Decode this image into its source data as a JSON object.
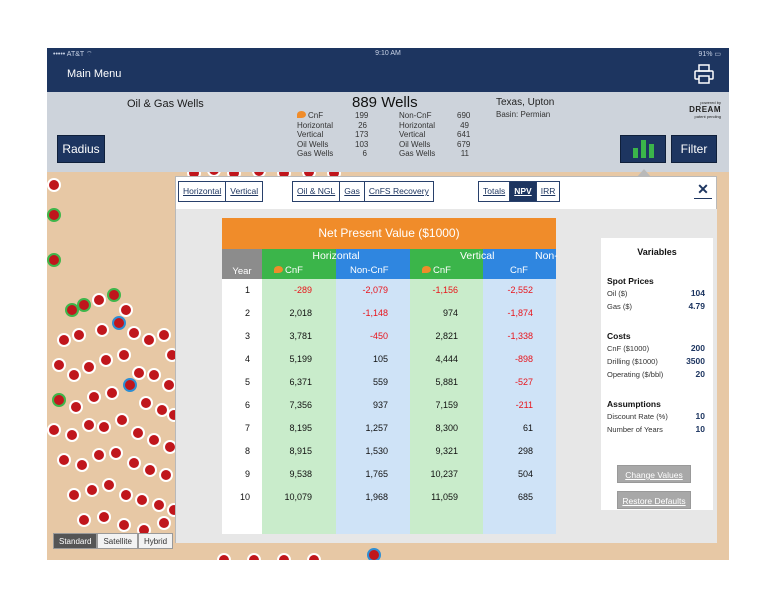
{
  "status_bar": {
    "carrier": "••••• AT&T ⌔",
    "time": "9:10 AM",
    "battery": "91% ▭"
  },
  "nav": {
    "main_menu": "Main Menu"
  },
  "info": {
    "title": "Oil & Gas Wells",
    "wells_count": "889 Wells",
    "cnf_stats": [
      {
        "label": "CnF",
        "value": "199"
      },
      {
        "label": "Horizontal",
        "value": "26"
      },
      {
        "label": "Vertical",
        "value": "173"
      },
      {
        "label": "Oil Wells",
        "value": "103"
      },
      {
        "label": "Gas Wells",
        "value": "6"
      }
    ],
    "noncnf_stats": [
      {
        "label": "Non-CnF",
        "value": "690"
      },
      {
        "label": "Horizontal",
        "value": "49"
      },
      {
        "label": "Vertical",
        "value": "641"
      },
      {
        "label": "Oil Wells",
        "value": "679"
      },
      {
        "label": "Gas Wells",
        "value": "11"
      }
    ],
    "location": "Texas, Upton",
    "basin": "Basin: Permian",
    "brand_small": "powered by",
    "brand": "DREAM",
    "brand_note": "patent pending"
  },
  "buttons": {
    "radius": "Radius",
    "filter": "Filter"
  },
  "map_types": [
    "Standard",
    "Satellite",
    "Hybrid"
  ],
  "popover": {
    "tabs_orientation": [
      "Horizontal",
      "Vertical"
    ],
    "tabs_product": [
      "Oil & NGL",
      "Gas",
      "CnFS Recovery"
    ],
    "tabs_metric": [
      "Totals",
      "NPV",
      "IRR"
    ],
    "active_metric": "NPV",
    "close": "✕"
  },
  "table": {
    "title": "Net Present Value ($1000)",
    "group_horizontal": "Horizontal",
    "group_vertical": "Vertical",
    "group_vertical_noncnf": "Non-",
    "year_header": "Year",
    "col_cnf": "CnF",
    "col_noncnf": "Non-CnF",
    "col_cnf_v": "CnF",
    "col_noncnf_v": "CnF",
    "rows": [
      {
        "year": "1",
        "h_cnf": "-289",
        "h_non": "-2,079",
        "v_cnf": "-1,156",
        "v_non": "-2,552"
      },
      {
        "year": "2",
        "h_cnf": "2,018",
        "h_non": "-1,148",
        "v_cnf": "974",
        "v_non": "-1,874"
      },
      {
        "year": "3",
        "h_cnf": "3,781",
        "h_non": "-450",
        "v_cnf": "2,821",
        "v_non": "-1,338"
      },
      {
        "year": "4",
        "h_cnf": "5,199",
        "h_non": "105",
        "v_cnf": "4,444",
        "v_non": "-898"
      },
      {
        "year": "5",
        "h_cnf": "6,371",
        "h_non": "559",
        "v_cnf": "5,881",
        "v_non": "-527"
      },
      {
        "year": "6",
        "h_cnf": "7,356",
        "h_non": "937",
        "v_cnf": "7,159",
        "v_non": "-211"
      },
      {
        "year": "7",
        "h_cnf": "8,195",
        "h_non": "1,257",
        "v_cnf": "8,300",
        "v_non": "61"
      },
      {
        "year": "8",
        "h_cnf": "8,915",
        "h_non": "1,530",
        "v_cnf": "9,321",
        "v_non": "298"
      },
      {
        "year": "9",
        "h_cnf": "9,538",
        "h_non": "1,765",
        "v_cnf": "10,237",
        "v_non": "504"
      },
      {
        "year": "10",
        "h_cnf": "10,079",
        "h_non": "1,968",
        "v_cnf": "11,059",
        "v_non": "685"
      }
    ]
  },
  "variables": {
    "title": "Variables",
    "spot_prices": "Spot Prices",
    "oil_label": "Oil ($)",
    "oil_value": "104",
    "gas_label": "Gas ($)",
    "gas_value": "4.79",
    "costs": "Costs",
    "cnf_cost_label": "CnF ($1000)",
    "cnf_cost_value": "200",
    "drilling_label": "Drilling ($1000)",
    "drilling_value": "3500",
    "operating_label": "Operating  ($/bbl)",
    "operating_value": "20",
    "assumptions": "Assumptions",
    "discount_label": "Discount Rate (%)",
    "discount_value": "10",
    "years_label": "Number of Years",
    "years_value": "10",
    "change_values": "Change Values",
    "restore_defaults": "Restore Defaults"
  },
  "colors": {
    "nav": "#1d3560",
    "orange": "#f08c2a",
    "green_header": "#3bb54a",
    "blue_header": "#2f86e0",
    "green_col": "#c9eccb",
    "blue_col": "#cfe3f7",
    "negative": "#e8141b"
  }
}
